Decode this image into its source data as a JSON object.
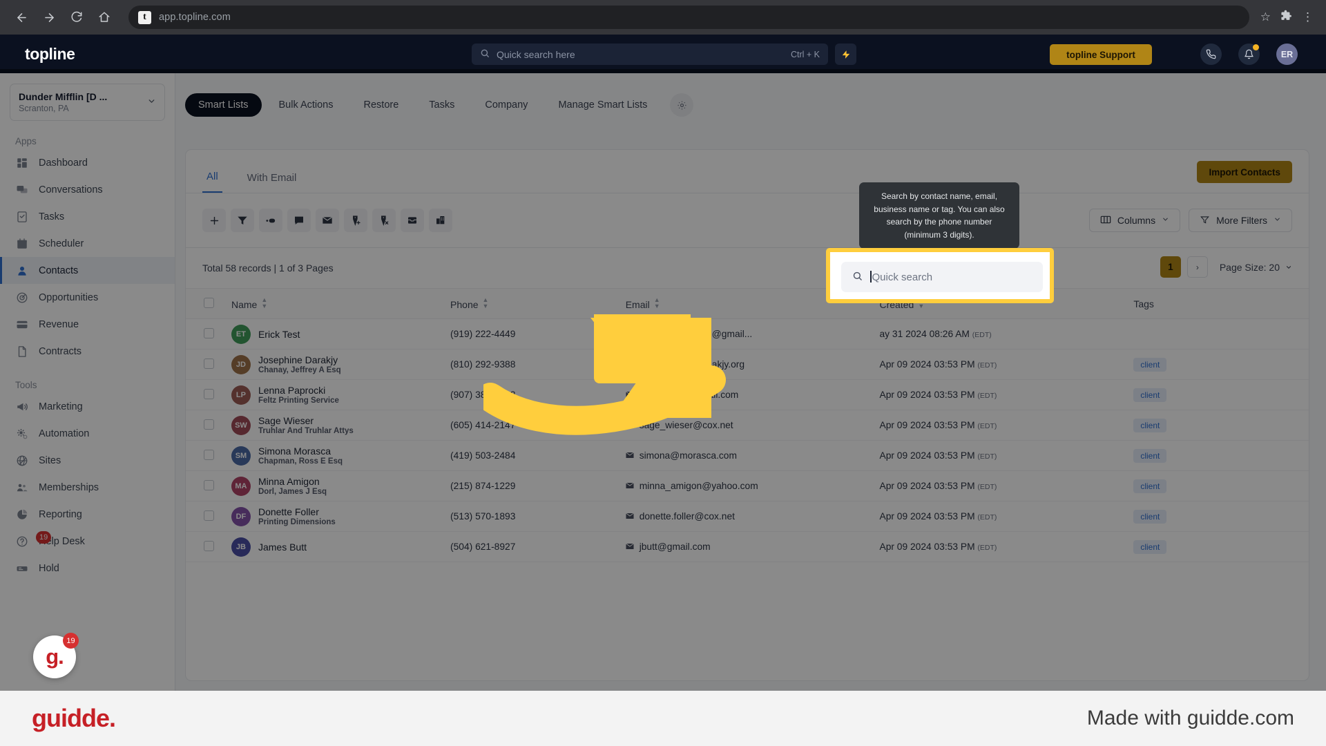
{
  "browser": {
    "back_icon": "back-arrow-icon",
    "forward_icon": "forward-arrow-icon",
    "reload_icon": "reload-icon",
    "home_icon": "home-icon",
    "favicon_letter": "t",
    "url": "app.topline.com",
    "star_icon": "☆",
    "extensions_icon": "puzzle-icon",
    "menu_icon": "⋮"
  },
  "topbar": {
    "brand": "topline",
    "search_placeholder": "Quick search here",
    "search_shortcut": "Ctrl + K",
    "bolt_icon": "⚡",
    "support_label": "topline Support",
    "phone_icon": "📞",
    "bell_icon": "🔔",
    "avatar_initials": "ER"
  },
  "sidebar": {
    "location_name": "Dunder Mifflin [D ...",
    "location_sub": "Scranton, PA",
    "sections": [
      {
        "label": "Apps",
        "items": [
          {
            "label": "Dashboard",
            "icon": "dashboard-icon",
            "active": false
          },
          {
            "label": "Conversations",
            "icon": "chat-icon",
            "active": false
          },
          {
            "label": "Tasks",
            "icon": "task-icon",
            "active": false
          },
          {
            "label": "Scheduler",
            "icon": "calendar-icon",
            "active": false
          },
          {
            "label": "Contacts",
            "icon": "person-icon",
            "active": true
          },
          {
            "label": "Opportunities",
            "icon": "target-icon",
            "active": false
          },
          {
            "label": "Revenue",
            "icon": "card-icon",
            "active": false
          },
          {
            "label": "Contracts",
            "icon": "document-icon",
            "active": false
          }
        ]
      },
      {
        "label": "Tools",
        "items": [
          {
            "label": "Marketing",
            "icon": "megaphone-icon",
            "active": false
          },
          {
            "label": "Automation",
            "icon": "gear-icon",
            "active": false
          },
          {
            "label": "Sites",
            "icon": "globe-icon",
            "active": false
          },
          {
            "label": "Memberships",
            "icon": "members-icon",
            "active": false
          },
          {
            "label": "Reporting",
            "icon": "pie-chart-icon",
            "active": false
          },
          {
            "label": "Help Desk",
            "icon": "help-icon",
            "active": false,
            "badge": "19"
          },
          {
            "label": "Hold",
            "icon": "hold-icon",
            "active": false
          }
        ]
      }
    ]
  },
  "tabs": [
    {
      "label": "Smart Lists",
      "active": true
    },
    {
      "label": "Bulk Actions",
      "active": false
    },
    {
      "label": "Restore",
      "active": false
    },
    {
      "label": "Tasks",
      "active": false
    },
    {
      "label": "Company",
      "active": false
    },
    {
      "label": "Manage Smart Lists",
      "active": false
    }
  ],
  "tabs_gear_icon": "gear-icon",
  "panel": {
    "subtabs": [
      {
        "label": "All",
        "active": true
      },
      {
        "label": "With Email",
        "active": false
      }
    ],
    "import_label": "Import Contacts",
    "toolbar_icons": [
      "add-contact-icon",
      "filter-icon",
      "merge-icon",
      "sms-icon",
      "email-icon",
      "add-tag-icon",
      "remove-tag-icon",
      "archive-icon",
      "company-icon"
    ],
    "columns_label": "Columns",
    "more_filters_label": "More Filters",
    "records_text": "Total 58 records | 1 of 3 Pages",
    "page_current": "1",
    "page_next_icon": "›",
    "page_size_label": "Page Size: 20"
  },
  "tooltip": {
    "text": "Search by contact name, email, business name or tag. You can also search by the phone number (minimum 3 digits)."
  },
  "quick_search": {
    "placeholder": "Quick search",
    "icon": "search-icon"
  },
  "table": {
    "headers": [
      "Name",
      "Phone",
      "Email",
      "Created",
      "Tags"
    ],
    "rows": [
      {
        "initials": "ET",
        "color": "#3f9b5a",
        "name": "Erick Test",
        "org": "",
        "phone": "(919) 222-4449",
        "email": "jabronipiebeating@gmail...",
        "created": "ay 31 2024 08:26 AM",
        "tz": "(EDT)",
        "tag": ""
      },
      {
        "initials": "JD",
        "color": "#9d7248",
        "name": "Josephine Darakjy",
        "org": "Chanay, Jeffrey A Esq",
        "phone": "(810) 292-9388",
        "email": "josephine_da......akjy.org",
        "created": "Apr 09 2024 03:53 PM",
        "tz": "(EDT)",
        "tag": "client"
      },
      {
        "initials": "LP",
        "color": "#9b5c54",
        "name": "Lenna Paprocki",
        "org": "Feltz Printing Service",
        "phone": "(907) 385-4412",
        "email": "lpaprocki@hotmail.com",
        "created": "Apr 09 2024 03:53 PM",
        "tz": "(EDT)",
        "tag": "client"
      },
      {
        "initials": "SW",
        "color": "#a04a58",
        "name": "Sage Wieser",
        "org": "Truhlar And Truhlar Attys",
        "phone": "(605) 414-2147",
        "email": "sage_wieser@cox.net",
        "created": "Apr 09 2024 03:53 PM",
        "tz": "(EDT)",
        "tag": "client"
      },
      {
        "initials": "SM",
        "color": "#4a6aa5",
        "name": "Simona Morasca",
        "org": "Chapman, Ross E Esq",
        "phone": "(419) 503-2484",
        "email": "simona@morasca.com",
        "created": "Apr 09 2024 03:53 PM",
        "tz": "(EDT)",
        "tag": "client"
      },
      {
        "initials": "MA",
        "color": "#b04367",
        "name": "Minna Amigon",
        "org": "Dorl, James J Esq",
        "phone": "(215) 874-1229",
        "email": "minna_amigon@yahoo.com",
        "created": "Apr 09 2024 03:53 PM",
        "tz": "(EDT)",
        "tag": "client"
      },
      {
        "initials": "DF",
        "color": "#8452a8",
        "name": "Donette Foller",
        "org": "Printing Dimensions",
        "phone": "(513) 570-1893",
        "email": "donette.foller@cox.net",
        "created": "Apr 09 2024 03:53 PM",
        "tz": "(EDT)",
        "tag": "client"
      },
      {
        "initials": "JB",
        "color": "#4a4ea5",
        "name": "James Butt",
        "org": "",
        "phone": "(504) 621-8927",
        "email": "jbutt@gmail.com",
        "created": "Apr 09 2024 03:53 PM",
        "tz": "(EDT)",
        "tag": "client"
      }
    ]
  },
  "footer": {
    "logo": "guidde.",
    "made_with": "Made with guidde.com",
    "float_logo": "g.",
    "float_badge": "19"
  },
  "colors": {
    "accent_gold": "#b08516",
    "highlight_yellow": "#ffce3d",
    "link_blue": "#2f6fd0",
    "dark_navy": "#0b1120"
  }
}
